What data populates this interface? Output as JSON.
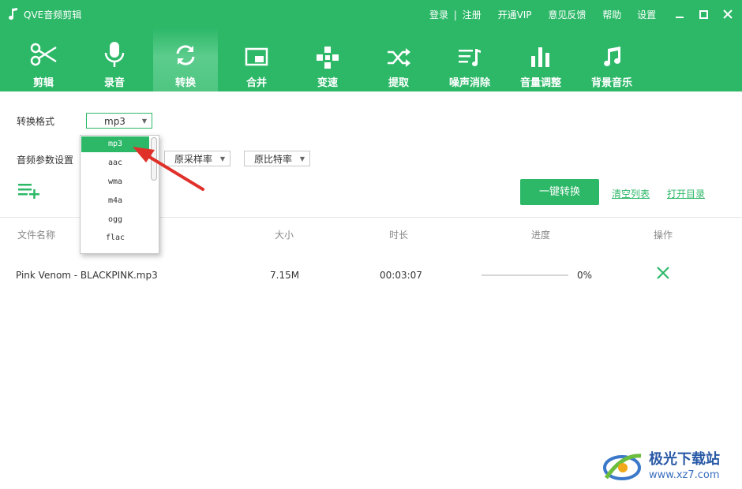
{
  "app": {
    "title": "QVE音频剪辑"
  },
  "toplinks": {
    "login": "登录",
    "sep": "|",
    "register": "注册",
    "vip": "开通VIP",
    "feedback": "意见反馈",
    "help": "帮助",
    "settings": "设置"
  },
  "tabs": [
    {
      "label": "剪辑",
      "icon": "scissors-icon"
    },
    {
      "label": "录音",
      "icon": "microphone-icon"
    },
    {
      "label": "转换",
      "icon": "refresh-icon"
    },
    {
      "label": "合并",
      "icon": "merge-icon"
    },
    {
      "label": "变速",
      "icon": "speed-icon"
    },
    {
      "label": "提取",
      "icon": "shuffle-icon"
    },
    {
      "label": "噪声消除",
      "icon": "noise-icon"
    },
    {
      "label": "音量调整",
      "icon": "volume-bars-icon"
    },
    {
      "label": "背景音乐",
      "icon": "music-note-icon"
    }
  ],
  "active_tab": "转换",
  "settings": {
    "format_label": "转换格式",
    "format_value": "mp3",
    "params_label": "音频参数设置",
    "sample_rate": "原采样率",
    "bitrate": "原比特率"
  },
  "dropdown": {
    "options": [
      "mp3",
      "aac",
      "wma",
      "m4a",
      "ogg",
      "flac"
    ],
    "selected": "mp3"
  },
  "actions": {
    "convert": "一键转换",
    "clear": "清空列表",
    "open_dir": "打开目录"
  },
  "table": {
    "headers": {
      "name": "文件名称",
      "size": "大小",
      "duration": "时长",
      "progress": "进度",
      "action": "操作"
    },
    "rows": [
      {
        "name": "Pink Venom - BLACKPINK.mp3",
        "size": "7.15M",
        "duration": "00:03:07",
        "progress": "0%",
        "progress_value": 0
      }
    ]
  },
  "watermark": {
    "text": "极光下载站",
    "url": "www.xz7.com"
  },
  "colors": {
    "brand": "#2db868",
    "arrow": "#e0302a"
  }
}
